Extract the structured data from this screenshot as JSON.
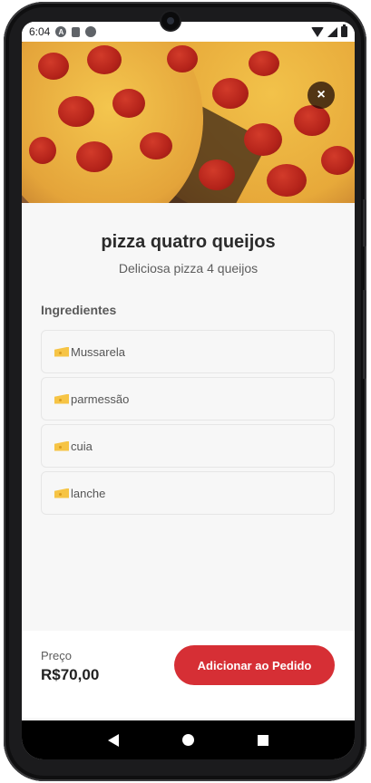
{
  "status_bar": {
    "time": "6:04",
    "app_icon_letter": "A"
  },
  "hero": {
    "image_name": "pepperoni-pizza-photo",
    "close_label": "×"
  },
  "product": {
    "title": "pizza quatro queijos",
    "description": "Deliciosa pizza 4 queijos"
  },
  "ingredients": {
    "heading": "Ingredientes",
    "icon": "cheese-icon",
    "items": [
      "Mussarela",
      "parmessão",
      "cuia",
      "lanche"
    ]
  },
  "footer": {
    "price_label": "Preço",
    "price_value": "R$70,00",
    "add_button_label": "Adicionar ao Pedido"
  },
  "colors": {
    "accent": "#d62f35",
    "background": "#f7f7f7",
    "text": "#2b2b2b"
  }
}
